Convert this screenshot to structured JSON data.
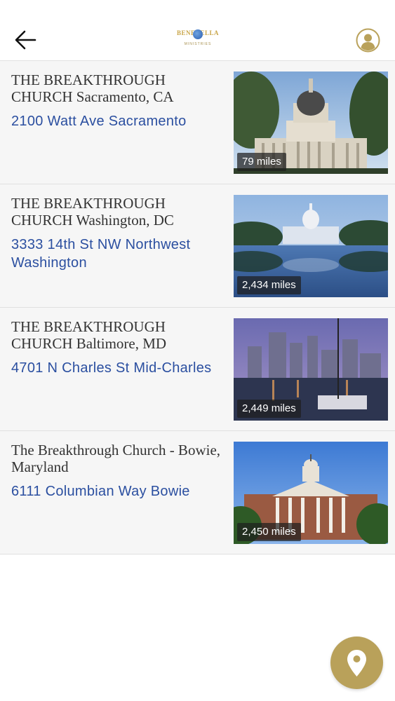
{
  "header": {
    "logo_text": "BENEDELLA",
    "logo_sub": "MINISTRIES"
  },
  "locations": [
    {
      "title": "THE BREAKTHROUGH CHURCH Sacramento, CA",
      "address": "2100 Watt Ave Sacramento",
      "distance": "79 miles"
    },
    {
      "title": "THE BREAKTHROUGH CHURCH Washington, DC",
      "address": "3333 14th St NW Northwest Washington",
      "distance": "2,434 miles"
    },
    {
      "title": "THE BREAKTHROUGH CHURCH Baltimore, MD",
      "address": "4701 N Charles St Mid-Charles",
      "distance": "2,449 miles"
    },
    {
      "title": "The Breakthrough Church - Bowie, Maryland",
      "address": "6111 Columbian Way Bowie",
      "distance": "2,450 miles"
    }
  ],
  "colors": {
    "accent": "#b9a15a",
    "link": "#2b4fa0"
  },
  "icons": {
    "back": "arrow-left-icon",
    "profile": "user-circle-icon",
    "map": "map-pin-icon"
  }
}
